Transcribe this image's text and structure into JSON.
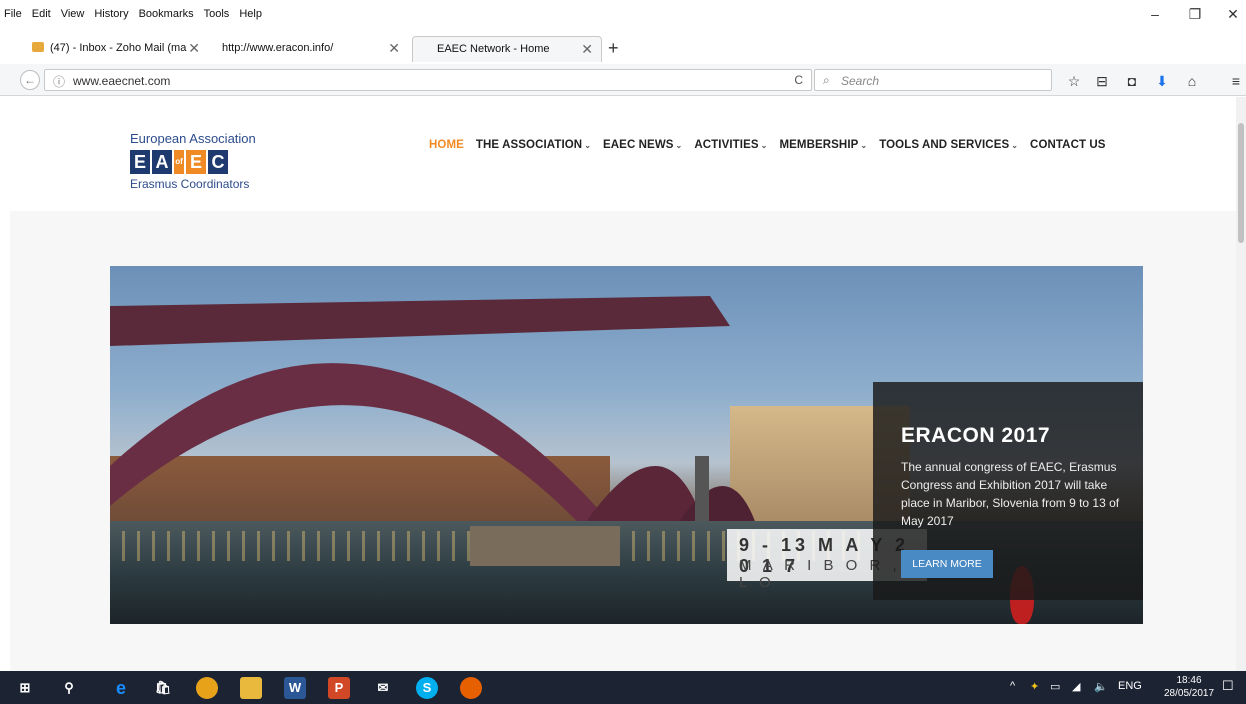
{
  "menubar": {
    "items": [
      "File",
      "Edit",
      "View",
      "History",
      "Bookmarks",
      "Tools",
      "Help"
    ]
  },
  "window_controls": {
    "minimize": "–",
    "restore": "❐",
    "close": "✕"
  },
  "tabs": [
    {
      "label": "(47) - Inbox - Zoho Mail (ma",
      "close": "✕"
    },
    {
      "label": "http://www.eracon.info/",
      "close": "✕"
    },
    {
      "label": "EAEC Network - Home",
      "close": "✕"
    }
  ],
  "new_tab": "+",
  "navbar": {
    "url": "www.eaecnet.com",
    "search_placeholder": "Search",
    "back": "←",
    "info": "ⓘ",
    "reload": "C",
    "icons": {
      "bookmark": "☆",
      "reader": "⊟",
      "pocket": "◘",
      "download": "⬇",
      "home": "⌂",
      "menu": "≡"
    }
  },
  "logo": {
    "top_text": "European Association",
    "letters": [
      "E",
      "A",
      "E",
      "C"
    ],
    "of_text": "of",
    "bottom_text": "Erasmus Coordinators"
  },
  "mainnav": {
    "items": [
      {
        "label": "HOME",
        "active": true,
        "dropdown": false
      },
      {
        "label": "THE ASSOCIATION",
        "active": false,
        "dropdown": true
      },
      {
        "label": "EAEC NEWS",
        "active": false,
        "dropdown": true
      },
      {
        "label": "ACTIVITIES",
        "active": false,
        "dropdown": true
      },
      {
        "label": "MEMBERSHIP",
        "active": false,
        "dropdown": true
      },
      {
        "label": "TOOLS AND SERVICES",
        "active": false,
        "dropdown": true
      },
      {
        "label": "CONTACT US",
        "active": false,
        "dropdown": false
      }
    ],
    "chevron": "⌄"
  },
  "hero": {
    "date_line": "9 - 13 M A Y  2 0 1 7",
    "place_line": "M A R I B O R , S L O",
    "title": "ERACON 2017",
    "description": "The annual congress of EAEC, Erasmus Congress and Exhibition 2017 will take place in Maribor, Slovenia from 9 to 13 of May 2017",
    "button": "LEARN MORE"
  },
  "taskbar": {
    "tray_lang": "ENG",
    "time": "18:46",
    "date": "28/05/2017",
    "tray_arrow": "^",
    "notification": "☐"
  },
  "colors": {
    "accent_orange": "#f08a24",
    "logo_navy": "#1e3a6e",
    "button_blue": "#4a8ac4",
    "taskbar": "#1c2333"
  }
}
